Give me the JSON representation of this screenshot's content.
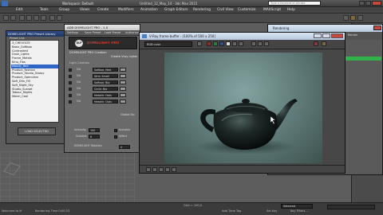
{
  "app": {
    "title": "Workspace: Default",
    "title_suffix": "Untitled_12_May_14 - 3ds Max 2015",
    "search_placeholder": "Type a keyword or phrase"
  },
  "menus": [
    "Edit",
    "Tools",
    "Group",
    "Views",
    "Create",
    "Modifiers",
    "Animation",
    "Graph Editors",
    "Rendering",
    "Civil View",
    "Customize",
    "MAXScript",
    "Help"
  ],
  "library": {
    "title": "DOMELIGHT PRO Preset Library",
    "list_label": "Preset List:",
    "items": [
      "3_CHEVOLTE",
      "Basic_Softbox",
      "Contrasted",
      "Dusk_Lights",
      "Frame_Metals",
      "Kino_Flos",
      "Moody_Red",
      "Product_Fashion",
      "Product_Studio_Glossy",
      "Product_Speculars",
      "Soft_Dim_Fill",
      "Soft_Night_Sky",
      "Studio_Sunset",
      "Tabour_Nights",
      "Warm_Cool"
    ],
    "selected_index": 6,
    "load_button": "LOAD SELECTED"
  },
  "domelight": {
    "window_title": "ADB DOMELIGHT PRO - 1.0",
    "menu": [
      "Settings",
      "Save Preset",
      "Load Preset",
      "Authorize"
    ],
    "brand": "DOMELIGHT PRO",
    "subtitle": "DOMELIGHT PRO Creation",
    "create_label": "Create Vray Lights",
    "section": "Light Controls",
    "rows": [
      {
        "on": "On",
        "preset": "Softbox_Med"
      },
      {
        "on": "On",
        "preset": "Strip_Small"
      },
      {
        "on": "On",
        "preset": "Softbox_Big"
      },
      {
        "on": "On",
        "preset": "Circle_Big"
      },
      {
        "on": "On",
        "preset": "Metallic_Dots"
      },
      {
        "on": "On",
        "preset": "Metallic_Dots"
      }
    ],
    "global_label": "Global Op",
    "intensity_label": "Intensity",
    "intensity_value": "100",
    "subdivs_label": "Subdivs",
    "subdivs_value": "8",
    "invisible_label": "Invisible",
    "affect_label": "Affect",
    "rotation_label": "DOMELIGHT Rotation",
    "rotation_value": "0"
  },
  "framebuffer": {
    "title": "V-Ray frame buffer - [100% of 500 x 250]",
    "channel": "RGB color"
  },
  "render_dialog": {
    "title": "Rendering",
    "tabs": [
      "Render"
    ]
  },
  "status": {
    "selection": "Selected",
    "grid": "Grid = 100,0",
    "time": "Rendering Time  0:00:23",
    "add_tag": "Add Time Tag",
    "set_key": "Set Key",
    "key_filters": "Key Filters...",
    "welcome": "Welcome to M"
  },
  "colors": {
    "accent_blue": "#2f66c7",
    "render_bg": "#6e8c89",
    "progress_green": "#2fb34a"
  }
}
